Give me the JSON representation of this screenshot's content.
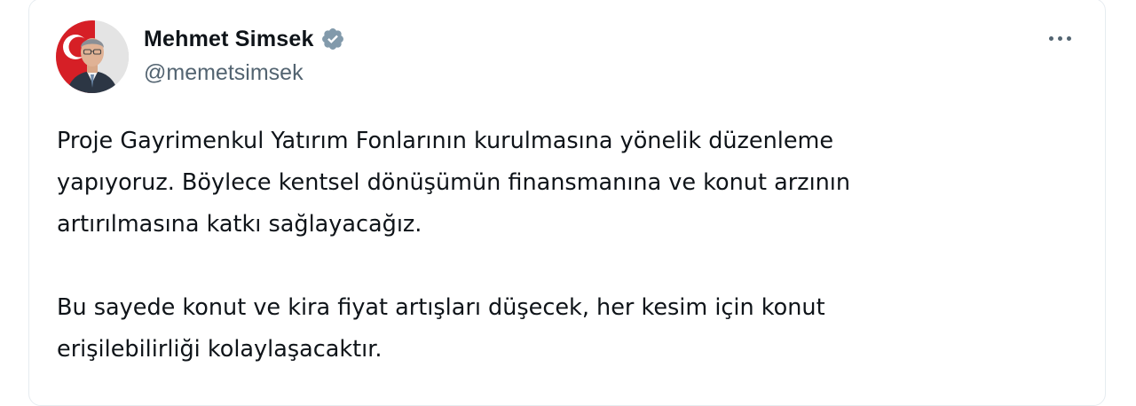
{
  "author": {
    "display_name": "Mehmet Simsek",
    "handle": "@memetsimsek",
    "verified": true,
    "verified_color": "#829aab",
    "avatar": "profile-photo"
  },
  "actions": {
    "more_icon": "more-horizontal-icon"
  },
  "tweet": {
    "paragraphs": [
      {
        "lines": [
          "Proje Gayrimenkul Yatırım Fonlarının kurulmasına yönelik düzenleme",
          "yapıyoruz. Böylece kentsel dönüşümün finansmanına ve konut arzının",
          "artırılmasına katkı sağlayacağız."
        ]
      },
      {
        "lines": [
          "Bu sayede konut ve kira fiyat artışları düşecek, her kesim için konut",
          "erişilebilirliği kolaylaşacaktır."
        ]
      }
    ]
  },
  "colors": {
    "text_primary": "#0f1419",
    "text_secondary": "#536471",
    "border": "#e6ecf0"
  }
}
